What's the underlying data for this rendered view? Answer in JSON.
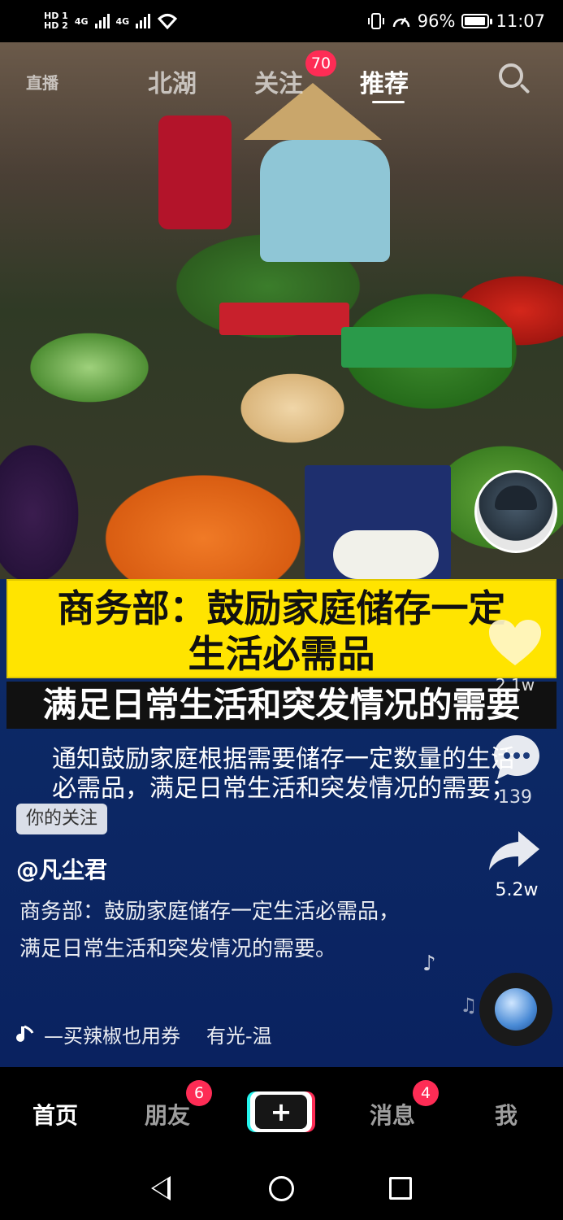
{
  "status_bar": {
    "network_1": "HD 1",
    "network_2": "HD 2",
    "signal_1": "4G",
    "signal_2": "4G",
    "battery_percent": "96%",
    "time": "11:07",
    "battery_level": 0.96
  },
  "top_nav": {
    "live": "直播",
    "local": "北湖",
    "following": "关注",
    "following_badge": "70",
    "recommend": "推荐"
  },
  "video": {
    "headline_line1": "商务部：鼓励家庭储存一定",
    "headline_line2": "生活必需品",
    "headline_sub": "满足日常生活和突发情况的需要",
    "subtitle": "通知鼓励家庭根据需要储存一定数量的生活必需品，满足日常生活和突发情况的需要；",
    "follow_tag": "你的关注",
    "author": "@凡尘君",
    "description": "商务部：鼓励家庭储存一定生活必需品，满足日常生活和突发情况的需要。",
    "music_track_1": "—买辣椒也用券",
    "music_track_2": "有光-温"
  },
  "right_rail": {
    "like_count": "2.1w",
    "comment_count": "139",
    "share_count": "5.2w"
  },
  "bottom_nav": {
    "home": "首页",
    "friends": "朋友",
    "friends_badge": "6",
    "create": "+",
    "messages": "消息",
    "messages_badge": "4",
    "me": "我"
  },
  "colors": {
    "accent_red": "#fe2c55",
    "accent_cyan": "#25f4ee",
    "headline_yellow": "#ffe400"
  },
  "icons": [
    "search-icon",
    "heart-icon",
    "comment-icon",
    "share-icon",
    "music-note-icon",
    "back-icon",
    "home-icon",
    "recent-apps-icon"
  ]
}
